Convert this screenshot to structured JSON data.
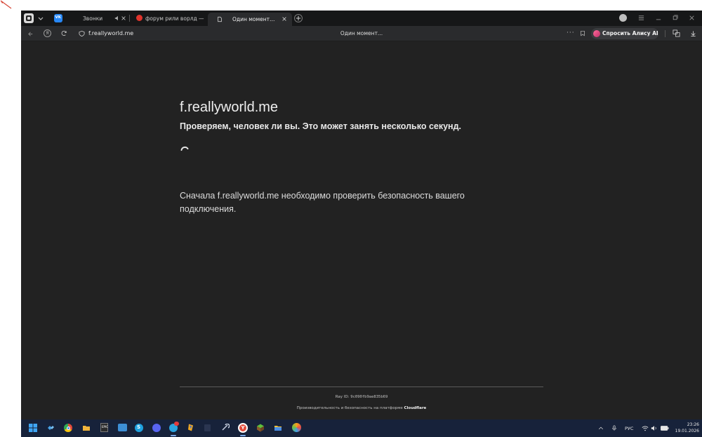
{
  "browser": {
    "tabs": [
      {
        "label": "Звонки"
      },
      {
        "label": "форум рили ворлд — Ян…"
      },
      {
        "label": "Один момент…"
      }
    ]
  },
  "addressbar": {
    "url": "f.reallyworld.me",
    "page_title": "Один момент...",
    "alice_label": "Спросить Алису AI"
  },
  "challenge": {
    "domain": "f.reallyworld.me",
    "subtitle": "Проверяем, человек ли вы. Это может занять несколько секунд.",
    "message": "Сначала f.reallyworld.me необходимо проверить безопасность вашего подключения.",
    "ray_label": "Ray ID:",
    "ray_id": "9c090fb9ae835b69",
    "perf_text": "Производительность и безопасность на платформе",
    "perf_brand": "Cloudflare"
  },
  "taskbar": {
    "language": "РУС",
    "time": "23:26",
    "date": "19.01.2026"
  },
  "colors": {
    "tab_strip": "#161718",
    "address_bar": "#2a2b2d",
    "page_bg": "#222222",
    "taskbar_bg": "#17223a",
    "alice_accent": "#e0467a"
  }
}
